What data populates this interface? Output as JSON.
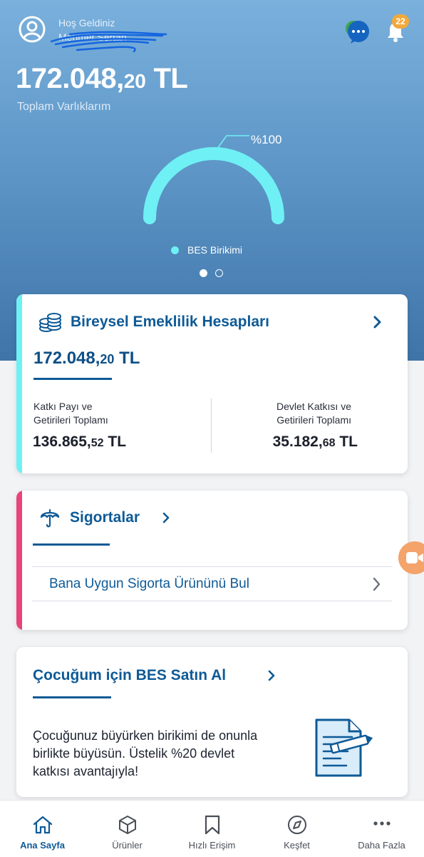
{
  "header": {
    "welcome": "Hoş Geldiniz",
    "username": "Mehmet Sertan",
    "notification_count": "22"
  },
  "summary": {
    "total_int": "172.048,",
    "total_dec": "20",
    "total_currency": " TL",
    "total_label": "Toplam Varlıklarım",
    "gauge_percent_label": "%100",
    "gauge_fill_fraction": 1.0,
    "legend_label": "BES Birikimi",
    "legend_color": "#6ff0f4",
    "pager": {
      "count": 2,
      "active": 1
    }
  },
  "bes_card": {
    "title": "Bireysel Emeklilik Hesapları",
    "accent_color": "#6ff0f4",
    "amount_int": "172.048,",
    "amount_dec": "20",
    "amount_currency": " TL",
    "left_label_1": "Katkı Payı ve",
    "left_label_2": "Getirileri Toplamı",
    "left_int": "136.865,",
    "left_dec": "52",
    "left_currency": " TL",
    "right_label_1": "Devlet Katkısı ve",
    "right_label_2": "Getirileri Toplamı",
    "right_int": "35.182,",
    "right_dec": "68",
    "right_currency": " TL"
  },
  "insurance_card": {
    "title": "Sigortalar",
    "accent_color": "#e8447a",
    "row_label": "Bana Uygun Sigorta Ürününü Bul"
  },
  "child_card": {
    "title": "Çocuğum için BES Satın Al",
    "body": "Çocuğunuz büyürken birikimi de onunla birlikte büyüsün. Üstelik %20 devlet katkısı avantajıyla!"
  },
  "nav": {
    "items": [
      {
        "label": "Ana Sayfa",
        "icon": "home-icon",
        "active": true
      },
      {
        "label": "Ürünler",
        "icon": "box-icon",
        "active": false
      },
      {
        "label": "Hızlı Erişim",
        "icon": "bookmark-icon",
        "active": false
      },
      {
        "label": "Keşfet",
        "icon": "compass-icon",
        "active": false
      },
      {
        "label": "Daha Fazla",
        "icon": "more-icon",
        "active": false
      }
    ]
  },
  "colors": {
    "brand_blue": "#0e5a96",
    "hero_top": "#7ab0dc",
    "hero_bottom": "#3f74a8",
    "gauge": "#6ff0f4",
    "badge": "#f2a93b"
  }
}
